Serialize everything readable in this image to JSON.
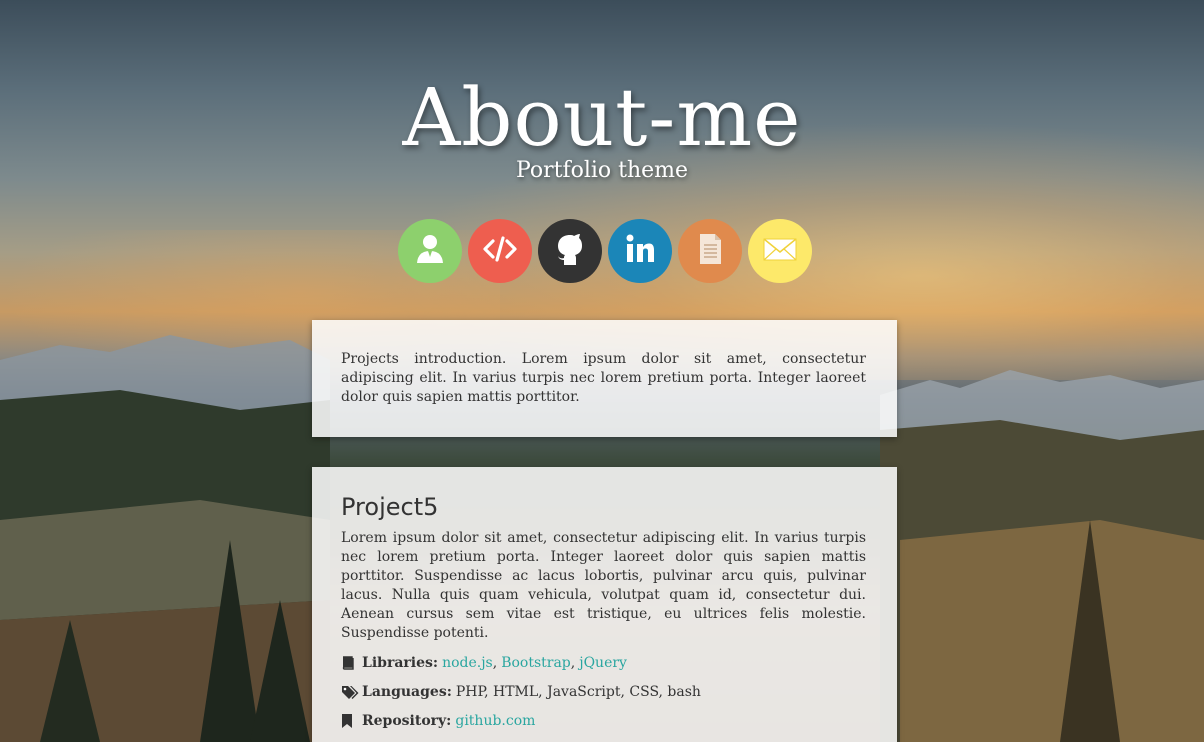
{
  "header": {
    "title": "About-me",
    "subtitle": "Portfolio theme"
  },
  "social": [
    {
      "name": "about",
      "icon": "user-icon",
      "color": "#8dd06d"
    },
    {
      "name": "projects",
      "icon": "code-icon",
      "color": "#ee5e4f"
    },
    {
      "name": "github",
      "icon": "github-icon",
      "color": "#333333"
    },
    {
      "name": "linkedin",
      "icon": "linkedin-icon",
      "color": "#1b86b8"
    },
    {
      "name": "resume",
      "icon": "document-icon",
      "color": "#e08a4d"
    },
    {
      "name": "email",
      "icon": "envelope-icon",
      "color": "#fde96a"
    }
  ],
  "intro": {
    "text": "Projects introduction. Lorem ipsum dolor sit amet, consectetur adipiscing elit. In varius turpis nec lorem pretium porta. Integer laoreet dolor quis sapien mattis porttitor."
  },
  "project": {
    "title": "Project5",
    "description": "Lorem ipsum dolor sit amet, consectetur adipiscing elit. In varius turpis nec lorem pretium porta. Integer laoreet dolor quis sapien mattis porttitor. Suspendisse ac lacus lobortis, pulvinar arcu quis, pulvinar lacus. Nulla quis quam vehicula, volutpat quam id, consectetur dui. Aenean cursus sem vitae est tristique, eu ultrices felis molestie. Suspendisse potenti.",
    "libraries_label": "Libraries:",
    "libraries": [
      "node.js",
      "Bootstrap",
      "jQuery"
    ],
    "languages_label": "Languages:",
    "languages": "PHP, HTML, JavaScript, CSS, bash",
    "repository_label": "Repository:",
    "repository": "github.com"
  },
  "colors": {
    "link": "#2aa6a0",
    "card_bg": "rgba(255,255,255,0.86)"
  }
}
